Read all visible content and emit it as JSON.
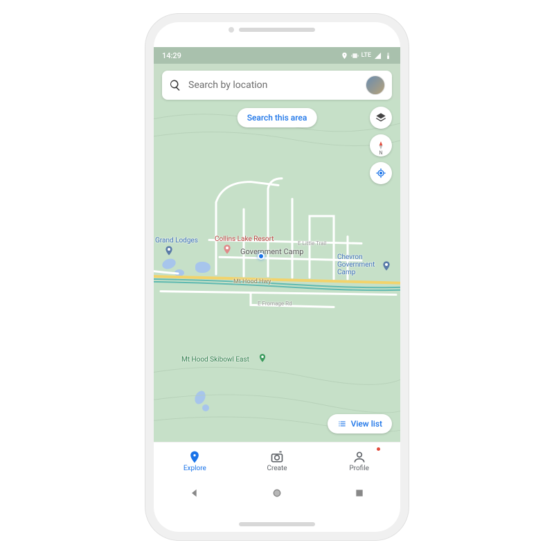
{
  "status": {
    "time": "14:29",
    "network": "LTE"
  },
  "search": {
    "placeholder": "Search by location"
  },
  "actions": {
    "search_area": "Search this area",
    "view_list": "View list"
  },
  "map": {
    "places": {
      "grand_lodges": "Grand Lodges",
      "collins_lake": "Collins Lake Resort",
      "gov_camp": "Government Camp",
      "chevron": "Chevron Government Camp",
      "skibowl": "Mt Hood Skibowl East",
      "hwy": "Mt Hood Hwy",
      "fromage": "E Fromage Rd",
      "little_trail": "E Little Trail"
    },
    "compass": "N"
  },
  "nav": {
    "explore": "Explore",
    "create": "Create",
    "profile": "Profile"
  }
}
